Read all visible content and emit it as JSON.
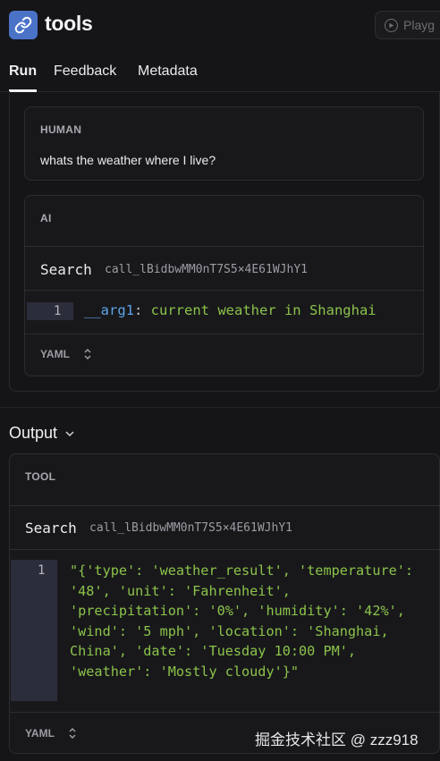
{
  "header": {
    "title": "tools",
    "app_icon": "link-icon",
    "playground_label": "Playg"
  },
  "tabs": [
    {
      "label": "Run",
      "active": true
    },
    {
      "label": "Feedback",
      "active": false
    },
    {
      "label": "Metadata",
      "active": false
    }
  ],
  "human": {
    "label": "HUMAN",
    "text": "whats the weather where I live?"
  },
  "ai": {
    "label": "AI",
    "tool_name": "Search",
    "call_id": "call_lBidbwMM0nT7S5×4E61WJhY1",
    "line_number": "1",
    "arg_key": "__arg1",
    "arg_sep": ": ",
    "arg_value": "current weather in Shanghai",
    "format_label": "YAML"
  },
  "output": {
    "heading": "Output",
    "tool_label": "TOOL",
    "tool_name": "Search",
    "call_id": "call_lBidbwMM0nT7S5×4E61WJhY1",
    "line_number": "1",
    "content": "\"{'type': 'weather_result', 'temperature': '48', 'unit': 'Fahrenheit', 'precipitation': '0%', 'humidity': '42%', 'wind': '5 mph', 'location': 'Shanghai, China', 'date': 'Tuesday 10:00 PM', 'weather': 'Mostly cloudy'}\"",
    "format_label": "YAML"
  },
  "watermark": "掘金技术社区 @ zzz918",
  "colors": {
    "accent": "#4a73c8",
    "code_key": "#5ea3e8",
    "code_string": "#8bc34a",
    "background": "#151517"
  }
}
